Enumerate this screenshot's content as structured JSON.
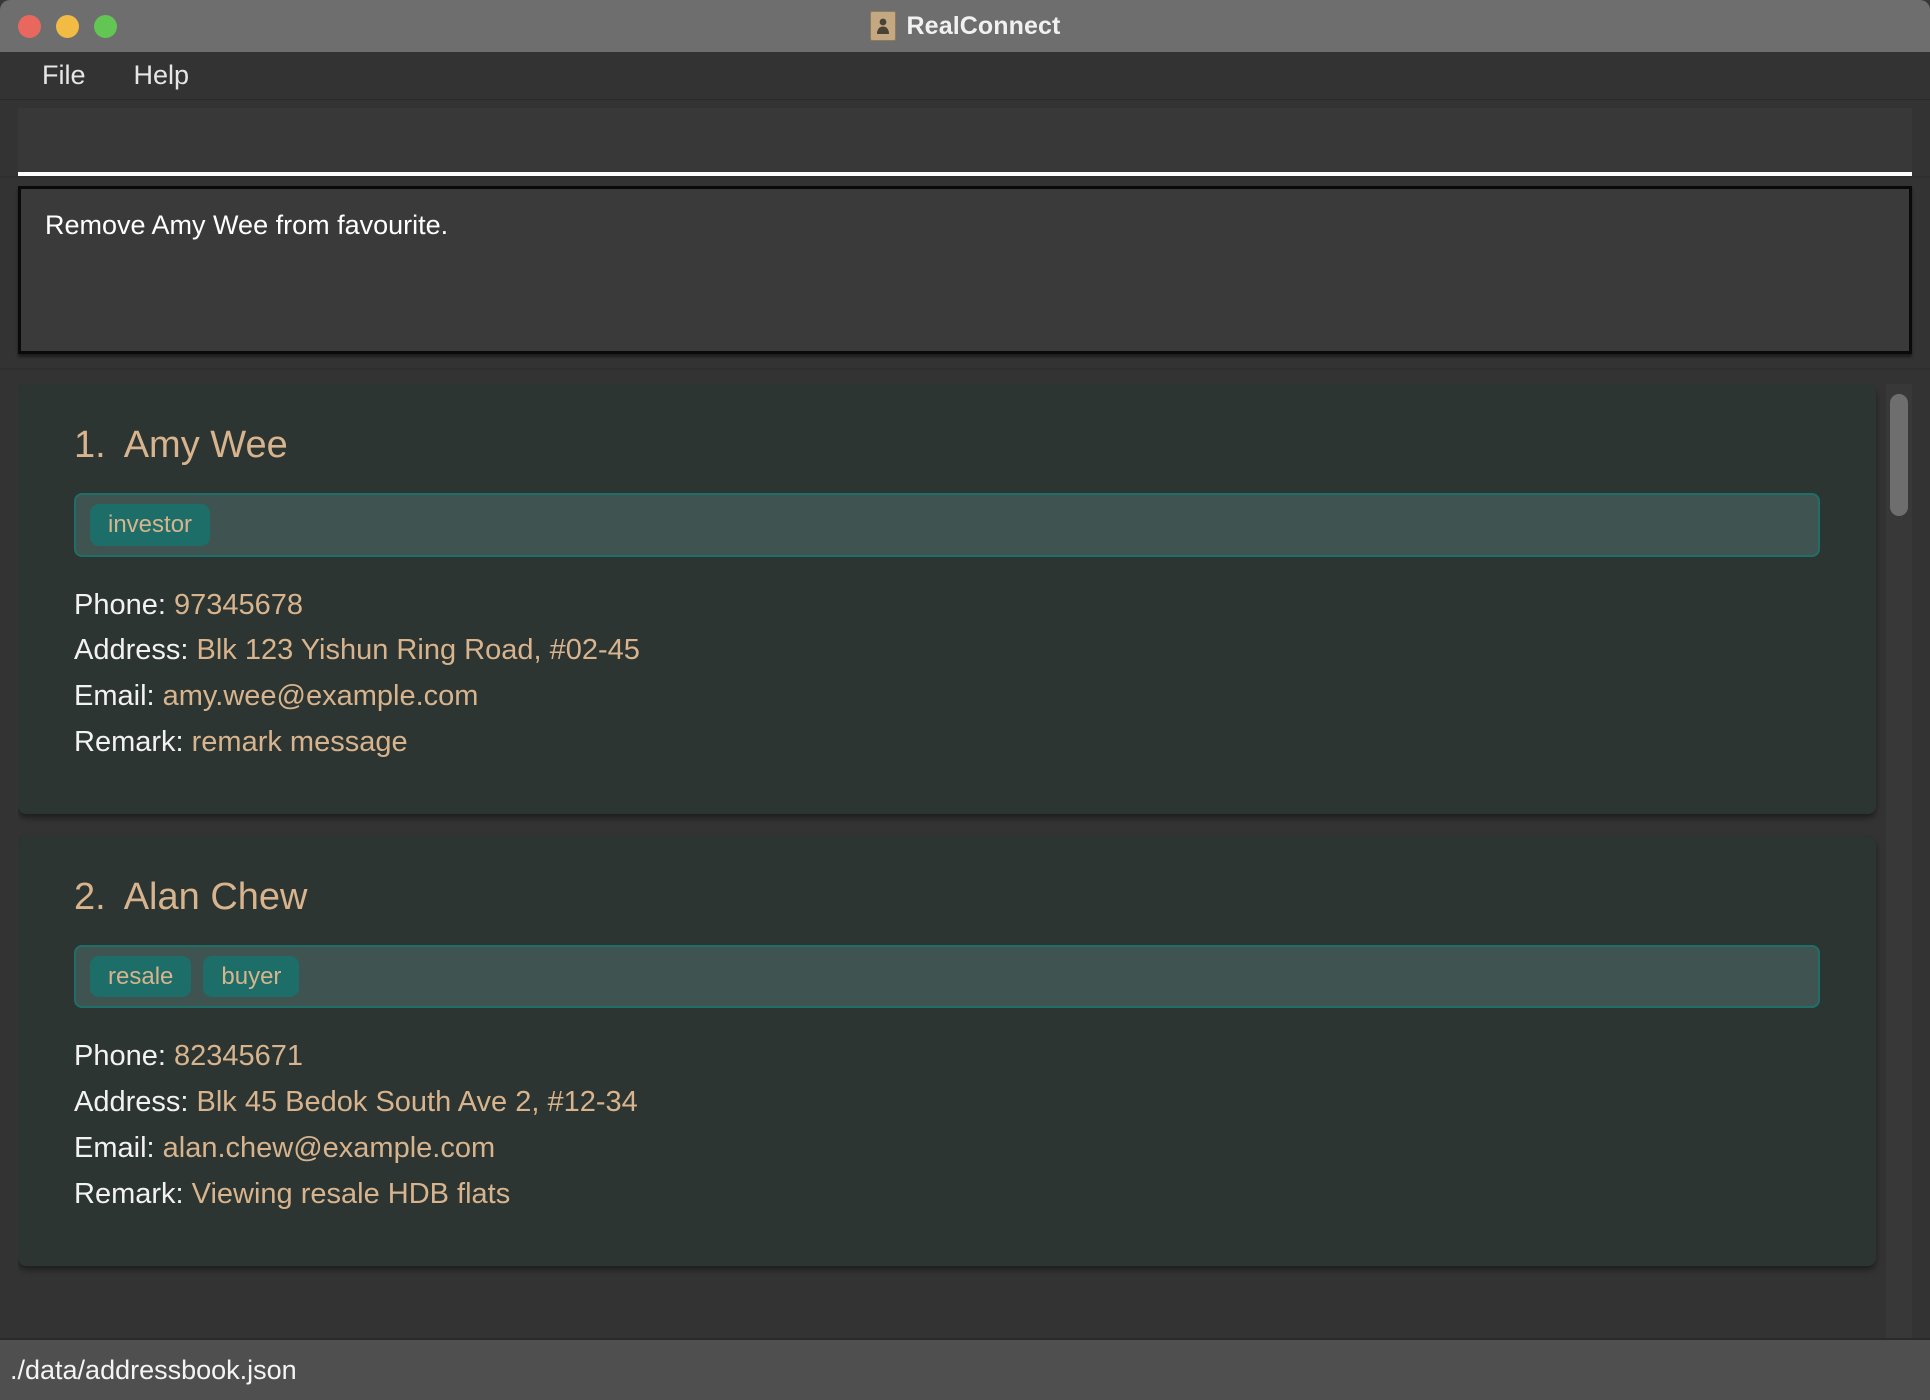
{
  "window": {
    "title": "RealConnect",
    "app_icon": "contact-person-icon",
    "controls": {
      "close": "close-window-button",
      "minimize": "minimize-window-button",
      "maximize": "maximize-window-button"
    },
    "colors": {
      "titlebar_bg": "#6e6e6e",
      "chrome_bg": "#333333",
      "card_bg": "#2c3531",
      "accent_tan": "#d7b48e",
      "tag_teal": "#1d6e68",
      "tag_bar_bg": "#3f5450",
      "statusbar_bg": "#4f4f4f"
    }
  },
  "menubar": {
    "items": [
      {
        "label": "File"
      },
      {
        "label": "Help"
      }
    ]
  },
  "command_box": {
    "value": "",
    "placeholder": "",
    "caret_visible": true
  },
  "result_display": {
    "message": "Remove Amy Wee from favourite."
  },
  "person_list": {
    "labels": {
      "phone": "Phone:",
      "address": "Address:",
      "email": "Email:",
      "remark": "Remark:"
    },
    "cards": [
      {
        "index": "1.",
        "name": "Amy Wee",
        "tags": [
          "investor"
        ],
        "phone": "97345678",
        "address": "Blk 123 Yishun Ring Road, #02-45",
        "email": "amy.wee@example.com",
        "remark": "remark message"
      },
      {
        "index": "2.",
        "name": "Alan Chew",
        "tags": [
          "resale",
          "buyer"
        ],
        "phone": "82345671",
        "address": "Blk 45 Bedok South Ave 2, #12-34",
        "email": "alan.chew@example.com",
        "remark": "Viewing resale HDB flats"
      }
    ]
  },
  "scrollbar": {
    "name": "person-list-scrollbar",
    "thumb_position_percent": 2,
    "thumb_size_percent": 20
  },
  "statusbar": {
    "save_location": "./data/addressbook.json"
  }
}
